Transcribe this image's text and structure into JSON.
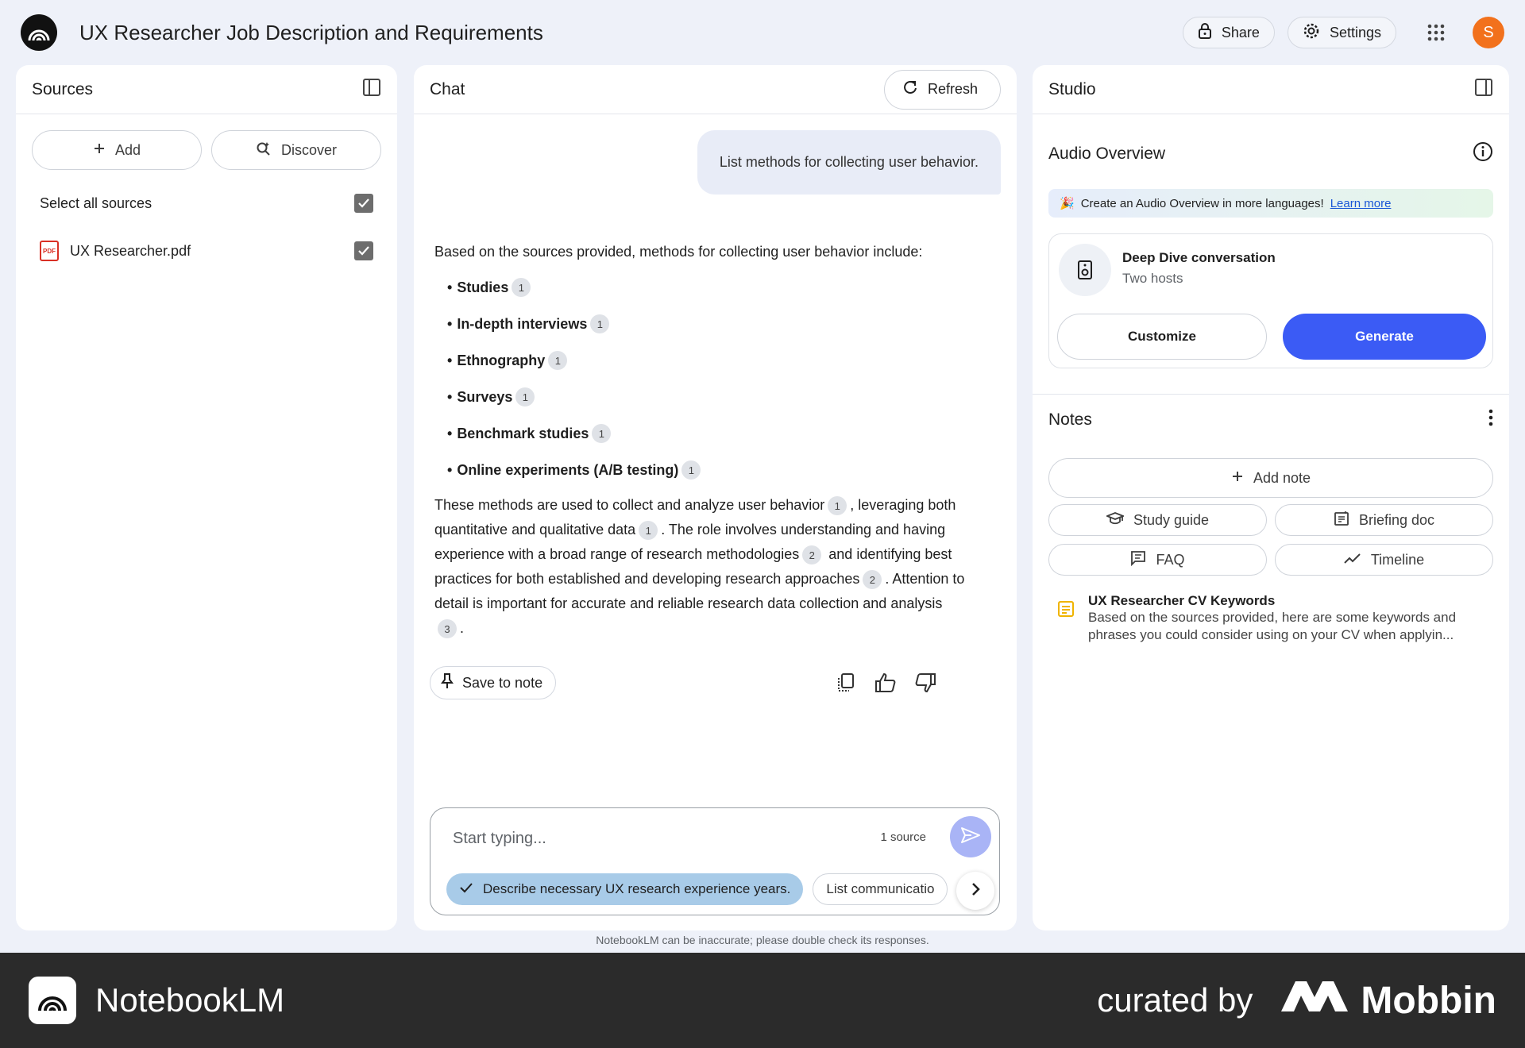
{
  "app": {
    "title": "UX Researcher Job Description and Requirements",
    "share_label": "Share",
    "settings_label": "Settings",
    "avatar_initial": "S"
  },
  "sources": {
    "title": "Sources",
    "add_label": "Add",
    "discover_label": "Discover",
    "select_all_label": "Select all sources",
    "pdf_badge": "PDF",
    "files": [
      {
        "name": "UX Researcher.pdf",
        "checked": true
      }
    ]
  },
  "chat": {
    "title": "Chat",
    "refresh_label": "Refresh",
    "user_message": "List methods for collecting user behavior.",
    "answer_intro": "Based on the sources provided, methods for collecting user behavior include:",
    "methods": [
      {
        "label": "Studies",
        "cite": "1"
      },
      {
        "label": "In-depth interviews",
        "cite": "1"
      },
      {
        "label": "Ethnography",
        "cite": "1"
      },
      {
        "label": "Surveys",
        "cite": "1"
      },
      {
        "label": "Benchmark studies",
        "cite": "1"
      },
      {
        "label": "Online experiments (A/B testing)",
        "cite": "1"
      }
    ],
    "paragraph": {
      "s1": "These methods are used to collect and analyze user behavior",
      "c1": "1",
      "s2": ", leveraging both quantitative and qualitative data",
      "c2": "1",
      "s3": ". The role involves understanding and having experience with a broad range of research methodologies",
      "c3": "2",
      "s4": " and identifying best practices for both established and developing research approaches",
      "c4": "2",
      "s5": ". Attention to detail is important for accurate and reliable research data collection and analysis",
      "c5": "3",
      "s6": "."
    },
    "save_to_note_label": "Save to note",
    "input_placeholder": "Start typing...",
    "source_count": "1 source",
    "suggestions": [
      "Describe necessary UX research experience years.",
      "List communicatio"
    ],
    "disclaimer": "NotebookLM can be inaccurate; please double check its responses."
  },
  "studio": {
    "title": "Studio",
    "audio_overview_title": "Audio Overview",
    "promo_emoji": "🎉",
    "promo_text": "Create an Audio Overview in more languages!",
    "promo_link": "Learn more",
    "audio_card_title": "Deep Dive conversation",
    "audio_card_subtitle": "Two hosts",
    "customize_label": "Customize",
    "generate_label": "Generate",
    "notes_title": "Notes",
    "add_note_label": "Add note",
    "note_buttons": [
      "Study guide",
      "Briefing doc",
      "FAQ",
      "Timeline"
    ],
    "note_item": {
      "title": "UX Researcher CV Keywords",
      "preview": "Based on the sources provided, here are some keywords and phrases you could consider using on your CV when applyin..."
    }
  },
  "footer": {
    "brand": "NotebookLM",
    "curated_by": "curated by",
    "mobbin": "Mobbin"
  },
  "colors": {
    "accent": "#3b5bf5",
    "background": "#eef1f9",
    "avatar": "#f2711c",
    "footer": "#2b2b2b"
  }
}
